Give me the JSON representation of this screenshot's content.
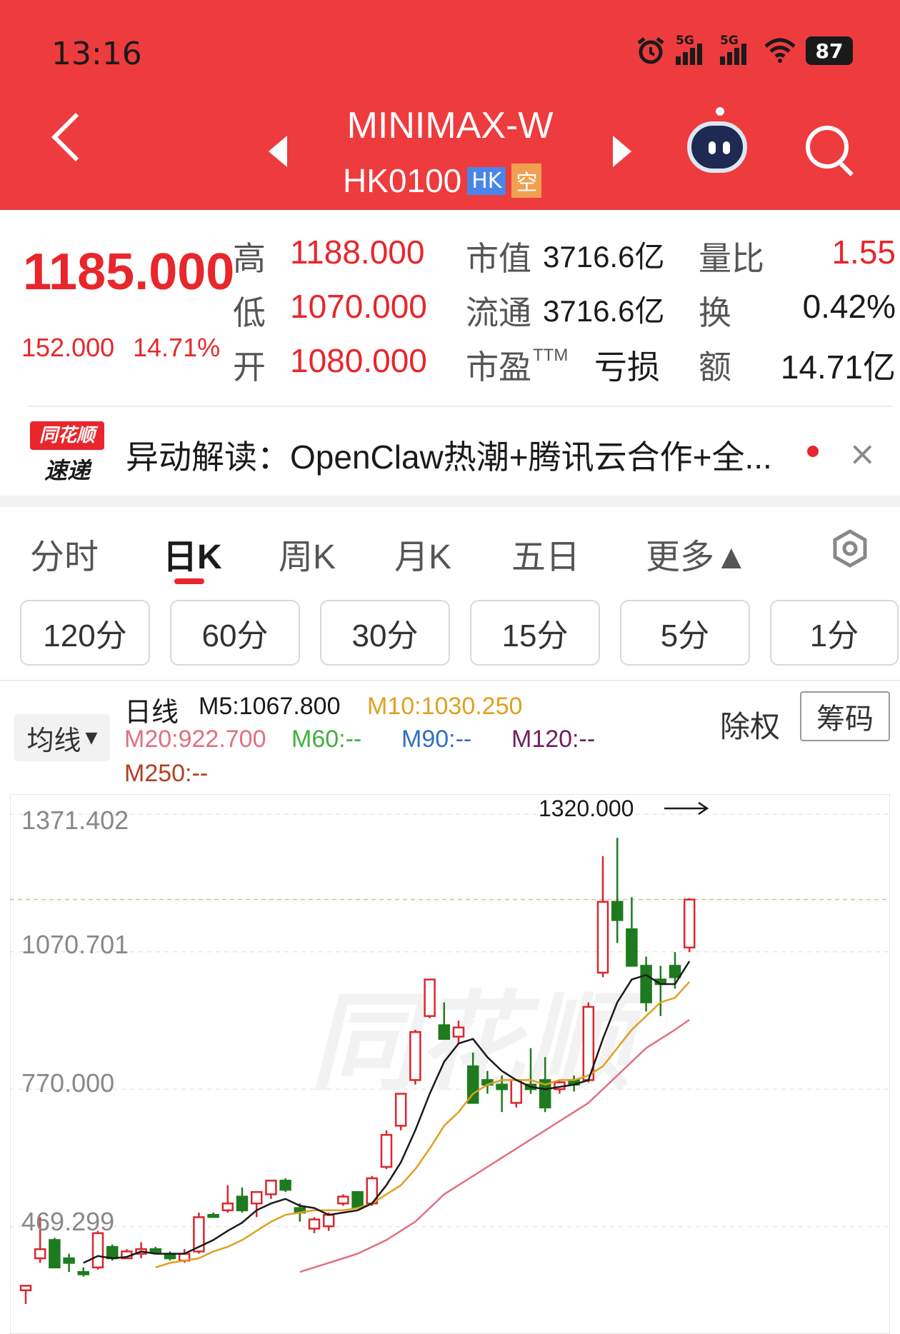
{
  "status_bar": {
    "time": "13:16",
    "battery": "87",
    "signal_label": "5G"
  },
  "header": {
    "title": "MINIMAX-W",
    "code": "HK0100",
    "badge_market": "HK",
    "badge_short": "空",
    "colors": {
      "background": "#ee3b3e",
      "badge_market": "#4a86e8",
      "badge_short": "#f0a050"
    }
  },
  "quote": {
    "price": "1185.000",
    "change": "152.000",
    "change_pct": "14.71%",
    "high_label": "高",
    "high": "1188.000",
    "low_label": "低",
    "low": "1070.000",
    "open_label": "开",
    "open": "1080.000",
    "mktcap_label": "市值",
    "mktcap": "3716.6亿",
    "float_label": "流通",
    "float": "3716.6亿",
    "pe_label": "市盈",
    "pe_sup": "TTM",
    "pe": "亏损",
    "vol_ratio_label": "量比",
    "vol_ratio": "1.55",
    "turnover_label": "换",
    "turnover": "0.42%",
    "amount_label": "额",
    "amount": "14.71亿"
  },
  "news": {
    "logo_top": "同花顺",
    "logo_bottom": "速递",
    "text": "异动解读：OpenClaw热潮+腾讯云合作+全...",
    "close": "×"
  },
  "tabs": [
    "分时",
    "日K",
    "周K",
    "月K",
    "五日",
    "更多▲"
  ],
  "active_tab": "日K",
  "sub_tabs": [
    "120分",
    "60分",
    "30分",
    "15分",
    "5分",
    "1分"
  ],
  "legend": {
    "ma_button": "均线",
    "period": "日线",
    "m5": "M5:1067.800",
    "m10": "M10:1030.250",
    "m20": "M20:922.700",
    "m60": "M60:--",
    "m90": "M90:--",
    "m120": "M120:--",
    "m250": "M250:--",
    "chuquan": "除权",
    "chouma": "筹码",
    "colors": {
      "m5": "#1a1a1a",
      "m10": "#e0a020",
      "m20": "#e07080",
      "m60": "#40b040",
      "m90": "#3070c0",
      "m120": "#702060",
      "m250": "#b04020"
    }
  },
  "chart_data": {
    "type": "candlestick",
    "y_ticks": [
      "1371.402",
      "1070.701",
      "770.000",
      "469.299"
    ],
    "ylim": [
      400,
      1400
    ],
    "max_annotation": "1320.000",
    "current_price_line": 1185,
    "colors": {
      "up": "#d9272e",
      "down": "#1e7a1e",
      "ma5": "#1a1a1a",
      "ma10": "#e0a020",
      "ma20": "#e07080"
    },
    "candles": [
      {
        "o": 330,
        "h": 340,
        "l": 300,
        "c": 340
      },
      {
        "o": 400,
        "h": 490,
        "l": 390,
        "c": 420
      },
      {
        "o": 440,
        "h": 445,
        "l": 380,
        "c": 380
      },
      {
        "o": 400,
        "h": 410,
        "l": 370,
        "c": 390
      },
      {
        "o": 370,
        "h": 380,
        "l": 360,
        "c": 365
      },
      {
        "o": 380,
        "h": 460,
        "l": 375,
        "c": 455
      },
      {
        "o": 425,
        "h": 430,
        "l": 395,
        "c": 400
      },
      {
        "o": 400,
        "h": 420,
        "l": 400,
        "c": 415
      },
      {
        "o": 410,
        "h": 435,
        "l": 400,
        "c": 420
      },
      {
        "o": 420,
        "h": 425,
        "l": 410,
        "c": 412
      },
      {
        "o": 410,
        "h": 415,
        "l": 395,
        "c": 400
      },
      {
        "o": 395,
        "h": 420,
        "l": 390,
        "c": 410
      },
      {
        "o": 415,
        "h": 500,
        "l": 410,
        "c": 490
      },
      {
        "o": 495,
        "h": 500,
        "l": 490,
        "c": 492
      },
      {
        "o": 505,
        "h": 560,
        "l": 500,
        "c": 520
      },
      {
        "o": 535,
        "h": 555,
        "l": 500,
        "c": 505
      },
      {
        "o": 520,
        "h": 530,
        "l": 490,
        "c": 545
      },
      {
        "o": 540,
        "h": 570,
        "l": 530,
        "c": 570
      },
      {
        "o": 570,
        "h": 575,
        "l": 545,
        "c": 550
      },
      {
        "o": 510,
        "h": 520,
        "l": 480,
        "c": 500
      },
      {
        "o": 465,
        "h": 490,
        "l": 455,
        "c": 485
      },
      {
        "o": 470,
        "h": 500,
        "l": 460,
        "c": 495
      },
      {
        "o": 520,
        "h": 540,
        "l": 515,
        "c": 535
      },
      {
        "o": 545,
        "h": 530,
        "l": 510,
        "c": 512
      },
      {
        "o": 520,
        "h": 580,
        "l": 515,
        "c": 575
      },
      {
        "o": 600,
        "h": 680,
        "l": 595,
        "c": 670
      },
      {
        "o": 690,
        "h": 760,
        "l": 680,
        "c": 760
      },
      {
        "o": 790,
        "h": 900,
        "l": 780,
        "c": 895
      },
      {
        "o": 930,
        "h": 1010,
        "l": 925,
        "c": 1010
      },
      {
        "o": 910,
        "h": 960,
        "l": 880,
        "c": 880
      },
      {
        "o": 885,
        "h": 920,
        "l": 870,
        "c": 905
      },
      {
        "o": 820,
        "h": 850,
        "l": 740,
        "c": 740
      },
      {
        "o": 790,
        "h": 810,
        "l": 760,
        "c": 780
      },
      {
        "o": 780,
        "h": 800,
        "l": 720,
        "c": 770
      },
      {
        "o": 740,
        "h": 780,
        "l": 730,
        "c": 790
      },
      {
        "o": 780,
        "h": 860,
        "l": 760,
        "c": 770
      },
      {
        "o": 790,
        "h": 840,
        "l": 720,
        "c": 730
      },
      {
        "o": 770,
        "h": 790,
        "l": 760,
        "c": 785
      },
      {
        "o": 790,
        "h": 800,
        "l": 765,
        "c": 780
      },
      {
        "o": 790,
        "h": 960,
        "l": 785,
        "c": 950
      },
      {
        "o": 1025,
        "h": 1280,
        "l": 1015,
        "c": 1180
      },
      {
        "o": 1180,
        "h": 1320,
        "l": 1090,
        "c": 1140
      },
      {
        "o": 1120,
        "h": 1190,
        "l": 1060,
        "c": 1040
      },
      {
        "o": 1040,
        "h": 1060,
        "l": 940,
        "c": 960
      },
      {
        "o": 1010,
        "h": 1040,
        "l": 930,
        "c": 1000
      },
      {
        "o": 1040,
        "h": 1070,
        "l": 990,
        "c": 1015
      },
      {
        "o": 1080,
        "h": 1188,
        "l": 1070,
        "c": 1185
      }
    ],
    "ma5": [
      null,
      null,
      null,
      null,
      390,
      405,
      400,
      403,
      415,
      410,
      410,
      410,
      425,
      440,
      460,
      478,
      505,
      520,
      530,
      515,
      510,
      495,
      500,
      505,
      520,
      560,
      610,
      680,
      760,
      830,
      870,
      880,
      840,
      810,
      790,
      775,
      770,
      775,
      780,
      790,
      880,
      960,
      1010,
      1020,
      1000,
      1000,
      1050
    ],
    "ma10": [
      null,
      null,
      null,
      null,
      null,
      null,
      null,
      null,
      null,
      380,
      390,
      395,
      400,
      415,
      425,
      440,
      460,
      480,
      495,
      500,
      505,
      505,
      505,
      510,
      520,
      540,
      560,
      595,
      640,
      690,
      720,
      760,
      780,
      790,
      790,
      790,
      780,
      790,
      790,
      800,
      820,
      860,
      900,
      930,
      960,
      970,
      1005
    ],
    "ma20": [
      null,
      null,
      null,
      null,
      null,
      null,
      null,
      null,
      null,
      null,
      null,
      null,
      null,
      null,
      null,
      null,
      null,
      null,
      null,
      370,
      380,
      390,
      400,
      410,
      425,
      440,
      460,
      480,
      510,
      540,
      560,
      580,
      600,
      620,
      640,
      660,
      680,
      700,
      720,
      740,
      770,
      800,
      830,
      860,
      880,
      900,
      922
    ]
  },
  "watermark": "同花顺"
}
